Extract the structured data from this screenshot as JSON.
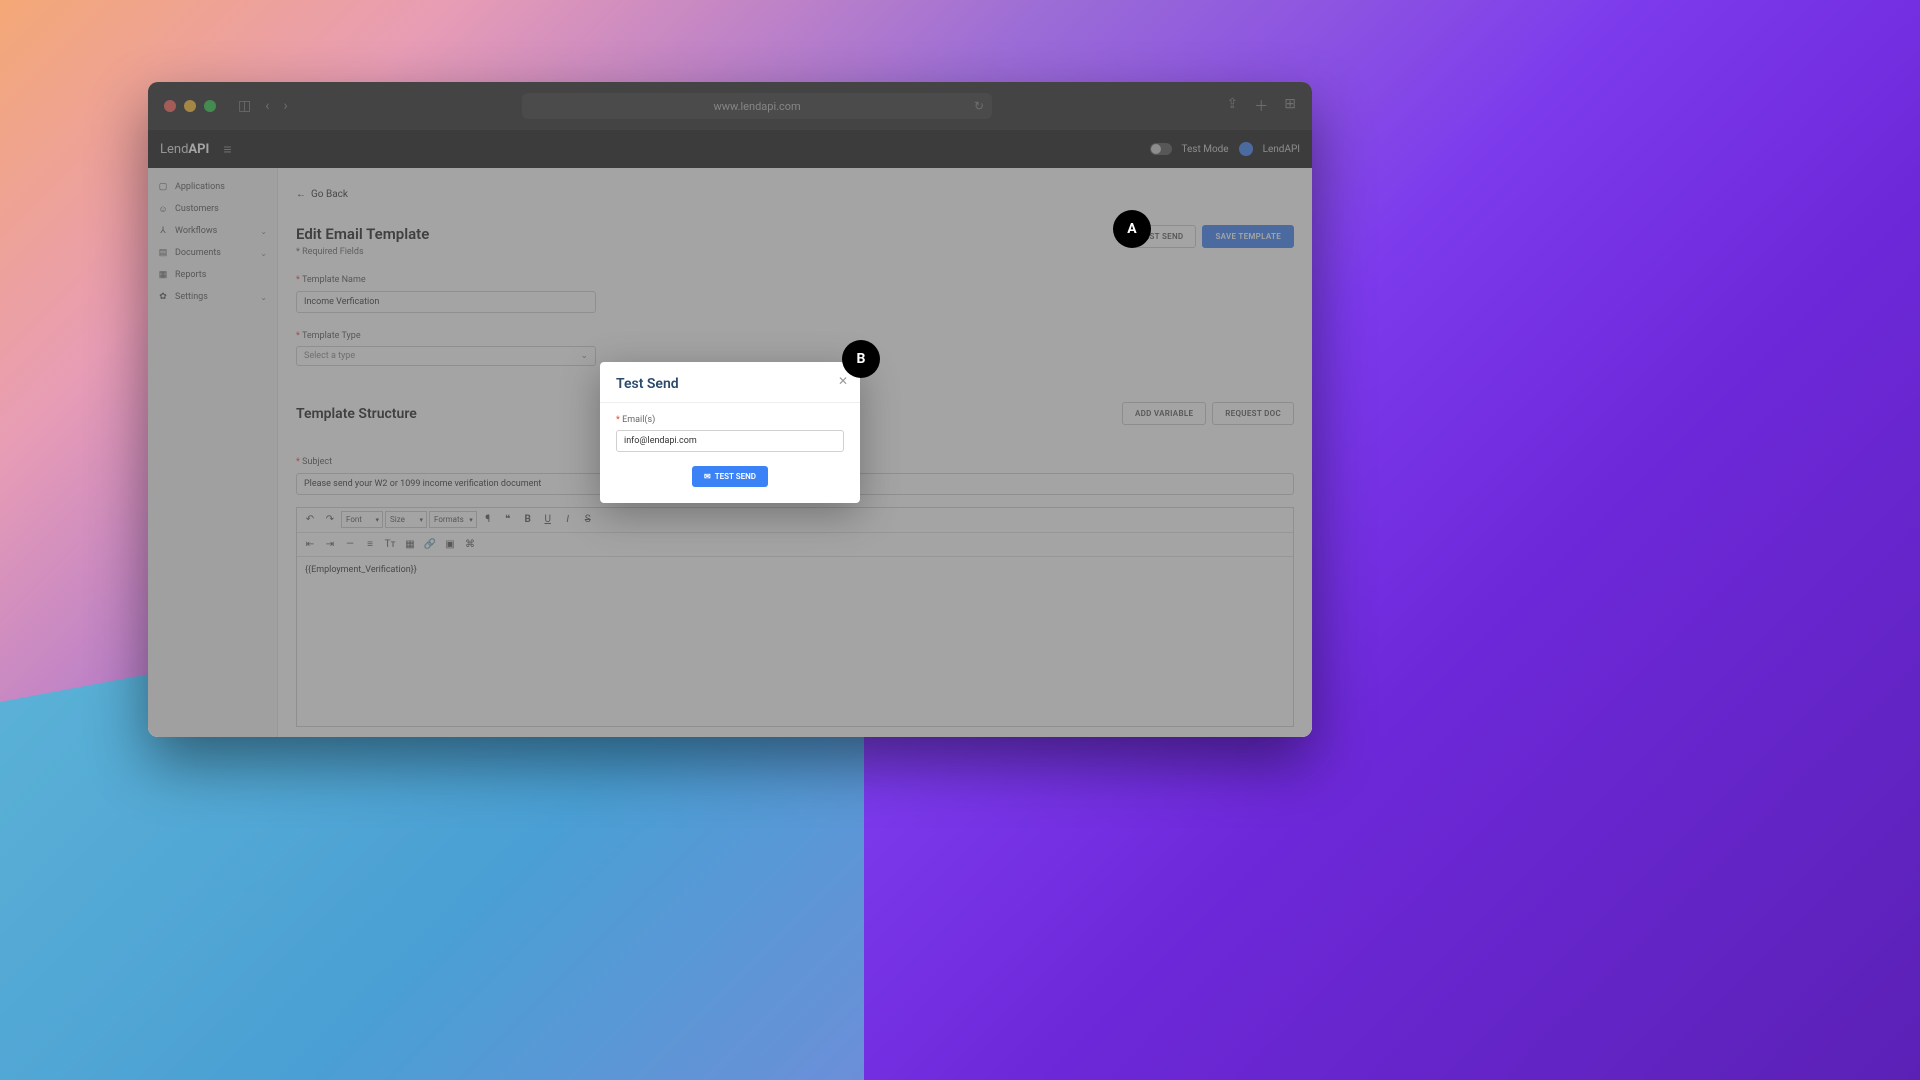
{
  "browser": {
    "url": "www.lendapi.com"
  },
  "app": {
    "logo_prefix": "Lend",
    "logo_suffix": "API",
    "test_mode_label": "Test Mode",
    "user_name": "LendAPI"
  },
  "sidebar": {
    "items": [
      {
        "icon": "▢",
        "label": "Applications",
        "has_children": false
      },
      {
        "icon": "☺",
        "label": "Customers",
        "has_children": false
      },
      {
        "icon": "⅄",
        "label": "Workflows",
        "has_children": true
      },
      {
        "icon": "▤",
        "label": "Documents",
        "has_children": true
      },
      {
        "icon": "▦",
        "label": "Reports",
        "has_children": false
      },
      {
        "icon": "✿",
        "label": "Settings",
        "has_children": true
      }
    ]
  },
  "main": {
    "go_back": "Go Back",
    "title": "Edit Email Template",
    "required_note": "* Required Fields",
    "buttons": {
      "test_send": "TEST SEND",
      "save": "SAVE TEMPLATE",
      "add_variable": "ADD VARIABLE",
      "request_doc": "REQUEST DOC"
    },
    "fields": {
      "name_label": "Template Name",
      "name_value": "Income Verfication",
      "type_label": "Template Type",
      "type_placeholder": "Select a type"
    },
    "structure_title": "Template Structure",
    "subject_label": "Subject",
    "subject_value": "Please send your W2 or 1099 income verification document",
    "toolbar": {
      "font": "Font",
      "size": "Size",
      "formats": "Formats"
    },
    "editor_content": "{{Employment_Verification}}"
  },
  "modal": {
    "title": "Test Send",
    "email_label": "Email(s)",
    "email_value": "info@lendapi.com",
    "button": "TEST SEND"
  },
  "callouts": {
    "a": "A",
    "b": "B"
  }
}
